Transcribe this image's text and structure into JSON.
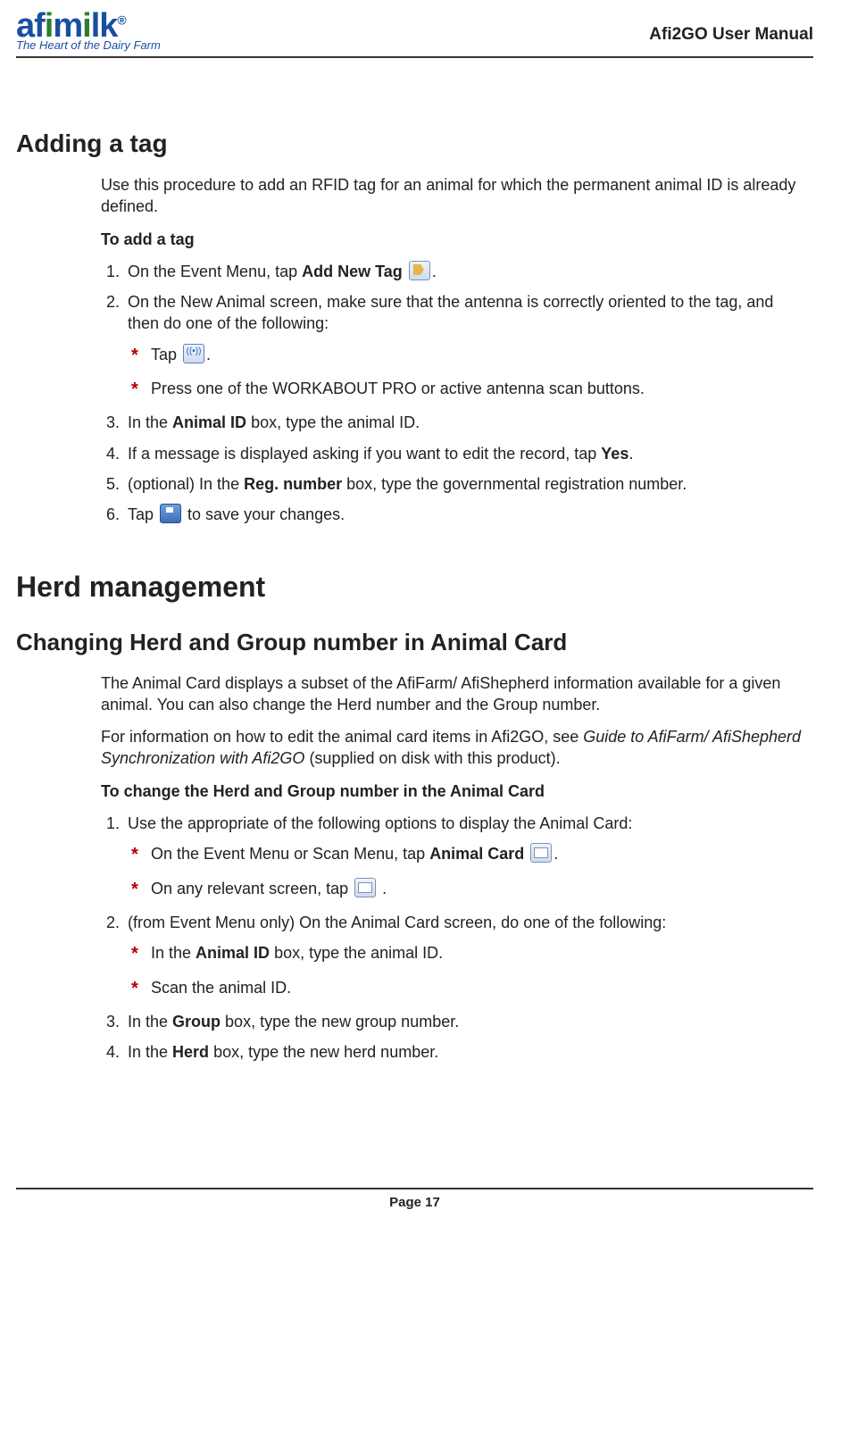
{
  "header": {
    "logo_main": "afimilk",
    "logo_tag": "The Heart of the Dairy Farm",
    "doc_title": "Afi2GO User Manual"
  },
  "s1": {
    "heading": "Adding a tag",
    "intro": "Use this procedure to add an RFID tag for an animal for which the permanent animal ID is already defined.",
    "lead": "To add a tag",
    "step1_a": "On the Event Menu, tap ",
    "step1_b": "Add New Tag",
    "step1_c": " ",
    "step1_d": ".",
    "step2": "On the New Animal screen, make sure that the antenna is correctly oriented to the tag, and then do one of the following:",
    "step2_a1": "Tap ",
    "step2_a2": ".",
    "step2_b": "Press one of the WORKABOUT PRO or active antenna scan buttons.",
    "step3_a": "In the ",
    "step3_b": "Animal ID",
    "step3_c": " box, type the animal ID.",
    "step4_a": "If a message is displayed asking if you want to edit the record, tap ",
    "step4_b": "Yes",
    "step4_c": ".",
    "step5_a": "(optional) In the ",
    "step5_b": "Reg. number",
    "step5_c": " box, type the governmental registration number.",
    "step6_a": "Tap ",
    "step6_b": " to save your changes."
  },
  "s2_heading": "Herd management",
  "s3": {
    "heading": "Changing Herd and Group number in Animal Card",
    "p1": "The Animal Card displays a subset of the AfiFarm/ AfiShepherd information available for a given animal.  You can also change the Herd number and the Group number.",
    "p2_a": "For information on how to edit the animal card items in Afi2GO, see ",
    "p2_i": "Guide to AfiFarm/ AfiShepherd Synchronization with Afi2GO",
    "p2_b": " (supplied on disk with this product).",
    "lead": "To change the Herd and Group number in the Animal Card",
    "step1": "Use the appropriate of the following options to display the Animal Card:",
    "step1_a1": "On the Event Menu or Scan Menu, tap ",
    "step1_a2": "Animal Card",
    "step1_a3": " ",
    "step1_a4": ".",
    "step1_b1": "On any relevant screen, tap ",
    "step1_b2": " .",
    "step2": "(from Event Menu only) On the Animal Card screen, do one of the following:",
    "step2_a1": "In the ",
    "step2_a2": "Animal ID",
    "step2_a3": " box, type the animal ID.",
    "step2_b": "Scan the animal ID.",
    "step3_a": "In the ",
    "step3_b": "Group",
    "step3_c": " box, type the new group number.",
    "step4_a": "In the ",
    "step4_b": "Herd",
    "step4_c": " box, type the new herd number."
  },
  "footer": "Page 17"
}
